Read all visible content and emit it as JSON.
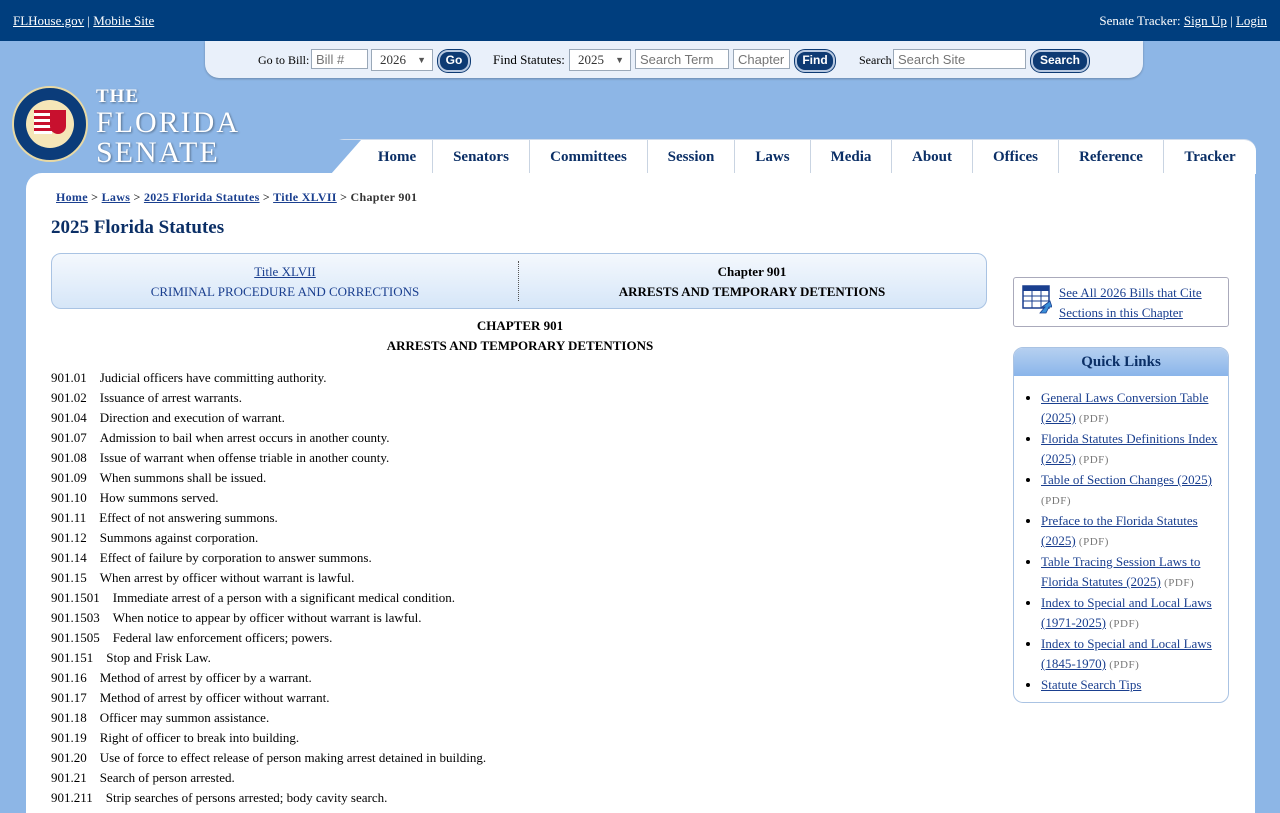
{
  "topbar": {
    "flhouse": "FLHouse.gov",
    "sep": "|",
    "mobile": "Mobile Site",
    "tracker_label": "Senate Tracker:",
    "signup": "Sign Up",
    "login": "Login"
  },
  "search": {
    "goto_label": "Go to Bill:",
    "bill_placeholder": "Bill #",
    "bill_year": "2026",
    "go": "Go",
    "find_label": "Find Statutes:",
    "statute_year": "2025",
    "term_placeholder": "Search Term",
    "chapter_placeholder": "Chapter",
    "find": "Find",
    "site_label": "Search",
    "site_placeholder": "Search Site",
    "search_btn": "Search"
  },
  "logo": {
    "the": "THE",
    "line1": "FLORIDA",
    "line2": "SENATE"
  },
  "nav": [
    "Home",
    "Senators",
    "Committees",
    "Session",
    "Laws",
    "Media",
    "About",
    "Offices",
    "Reference",
    "Tracker"
  ],
  "breadcrumb": {
    "home": "Home",
    "laws": "Laws",
    "statutes": "2025 Florida Statutes",
    "title": "Title XLVII",
    "current": "Chapter 901",
    "sep": ">"
  },
  "page_title": "2025 Florida Statutes",
  "titlebox": {
    "title_link": "Title XLVII",
    "title_name": "CRIMINAL PROCEDURE AND CORRECTIONS",
    "chapter": "Chapter 901",
    "chapter_name": "ARRESTS AND TEMPORARY DETENTIONS"
  },
  "chapter_heading": {
    "line1": "CHAPTER 901",
    "line2": "ARRESTS AND TEMPORARY DETENTIONS"
  },
  "sections": [
    {
      "num": "901.01",
      "title": "Judicial officers have committing authority."
    },
    {
      "num": "901.02",
      "title": "Issuance of arrest warrants."
    },
    {
      "num": "901.04",
      "title": "Direction and execution of warrant."
    },
    {
      "num": "901.07",
      "title": "Admission to bail when arrest occurs in another county."
    },
    {
      "num": "901.08",
      "title": "Issue of warrant when offense triable in another county."
    },
    {
      "num": "901.09",
      "title": "When summons shall be issued."
    },
    {
      "num": "901.10",
      "title": "How summons served."
    },
    {
      "num": "901.11",
      "title": "Effect of not answering summons."
    },
    {
      "num": "901.12",
      "title": "Summons against corporation."
    },
    {
      "num": "901.14",
      "title": "Effect of failure by corporation to answer summons."
    },
    {
      "num": "901.15",
      "title": "When arrest by officer without warrant is lawful."
    },
    {
      "num": "901.1501",
      "title": "Immediate arrest of a person with a significant medical condition."
    },
    {
      "num": "901.1503",
      "title": "When notice to appear by officer without warrant is lawful."
    },
    {
      "num": "901.1505",
      "title": "Federal law enforcement officers; powers."
    },
    {
      "num": "901.151",
      "title": "Stop and Frisk Law."
    },
    {
      "num": "901.16",
      "title": "Method of arrest by officer by a warrant."
    },
    {
      "num": "901.17",
      "title": "Method of arrest by officer without warrant."
    },
    {
      "num": "901.18",
      "title": "Officer may summon assistance."
    },
    {
      "num": "901.19",
      "title": "Right of officer to break into building."
    },
    {
      "num": "901.20",
      "title": "Use of force to effect release of person making arrest detained in building."
    },
    {
      "num": "901.21",
      "title": "Search of person arrested."
    },
    {
      "num": "901.211",
      "title": "Strip searches of persons arrested; body cavity search."
    }
  ],
  "cite_box": {
    "text": "See All 2026 Bills that Cite Sections in this Chapter",
    "icon": "table-arrow-icon"
  },
  "quick_links": {
    "heading": "Quick Links",
    "items": [
      {
        "label": "General Laws Conversion Table (2025)",
        "pdf": "(PDF)"
      },
      {
        "label": "Florida Statutes Definitions Index (2025)",
        "pdf": "(PDF)"
      },
      {
        "label": "Table of Section Changes (2025)",
        "pdf": "(PDF)"
      },
      {
        "label": "Preface to the Florida Statutes (2025)",
        "pdf": "(PDF)"
      },
      {
        "label": "Table Tracing Session Laws to Florida Statutes (2025)",
        "pdf": "(PDF)"
      },
      {
        "label": "Index to Special and Local Laws (1971-2025)",
        "pdf": "(PDF)"
      },
      {
        "label": "Index to Special and Local Laws (1845-1970)",
        "pdf": "(PDF)"
      },
      {
        "label": "Statute Search Tips",
        "pdf": ""
      }
    ]
  },
  "colors": {
    "header": "#003e7e",
    "background": "#8db6e6",
    "link": "#1a3f8f",
    "heading": "#0b2f66"
  }
}
